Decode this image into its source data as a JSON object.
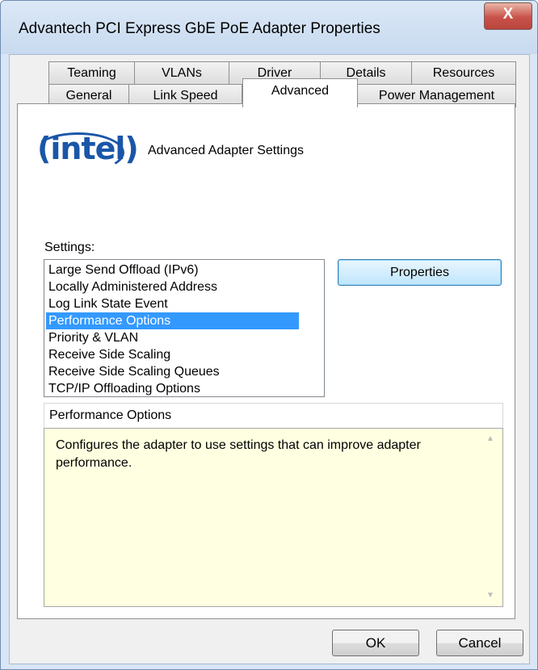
{
  "window": {
    "title": "Advantech PCI Express GbE PoE Adapter Properties",
    "close_label": "X"
  },
  "tabs_row1": [
    {
      "label": "Teaming"
    },
    {
      "label": "VLANs"
    },
    {
      "label": "Driver"
    },
    {
      "label": "Details"
    },
    {
      "label": "Resources"
    }
  ],
  "tabs_row2": [
    {
      "label": "General"
    },
    {
      "label": "Link Speed"
    },
    {
      "label": "Advanced",
      "active": true
    },
    {
      "label": "Power Management"
    }
  ],
  "brand": {
    "logo_text": "intel",
    "heading": "Advanced Adapter Settings"
  },
  "settings": {
    "label": "Settings:",
    "items": [
      "Large Send Offload (IPv6)",
      "Locally Administered Address",
      "Log Link State Event",
      "Performance Options",
      "Priority & VLAN",
      "Receive Side Scaling",
      "Receive Side Scaling Queues",
      "TCP/IP Offloading Options"
    ],
    "selected": "Performance Options"
  },
  "properties_button": "Properties",
  "description": {
    "title": "Performance Options",
    "text": "Configures the adapter to use settings that can improve adapter performance."
  },
  "buttons": {
    "ok": "OK",
    "cancel": "Cancel"
  },
  "colors": {
    "selection": "#3399ff",
    "description_bg": "#ffffe1",
    "intel_blue": "#1a56a8"
  }
}
